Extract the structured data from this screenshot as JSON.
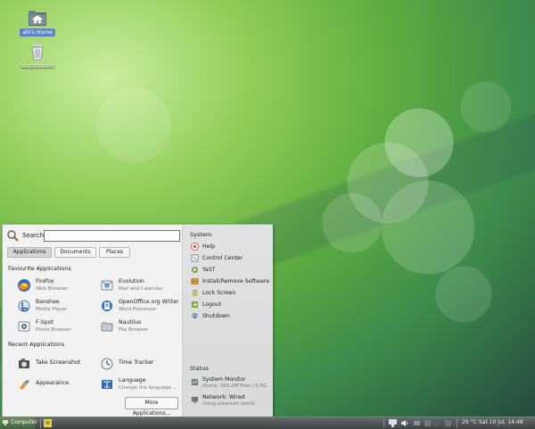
{
  "desktop": {
    "icons": [
      {
        "label": "ahl's Home",
        "icon": "home-folder-icon"
      },
      {
        "label": "Wastebasket",
        "icon": "trash-icon"
      }
    ]
  },
  "menu": {
    "search": {
      "label": "Search:",
      "value": ""
    },
    "tabs": [
      {
        "label": "Applications",
        "active": true
      },
      {
        "label": "Documents",
        "active": false
      },
      {
        "label": "Places",
        "active": false
      }
    ],
    "favourites_heading": "Favourite Applications",
    "favourites": [
      {
        "name": "Firefox",
        "description": "Web Browser",
        "icon": "firefox-icon"
      },
      {
        "name": "Evolution",
        "description": "Mail and Calendar",
        "icon": "evolution-icon"
      },
      {
        "name": "Banshee",
        "description": "Media Player",
        "icon": "banshee-icon"
      },
      {
        "name": "OpenOffice.org Writer",
        "description": "Word Processor",
        "icon": "writer-icon"
      },
      {
        "name": "F-Spot",
        "description": "Photo Browser",
        "icon": "fspot-icon"
      },
      {
        "name": "Nautilus",
        "description": "File Browser",
        "icon": "nautilus-icon"
      }
    ],
    "recent_heading": "Recent Applications",
    "recent": [
      {
        "name": "Take Screenshot",
        "description": "",
        "icon": "screenshot-icon"
      },
      {
        "name": "Time Tracker",
        "description": "",
        "icon": "time-tracker-icon"
      },
      {
        "name": "Appearance",
        "description": "",
        "icon": "appearance-icon"
      },
      {
        "name": "Language",
        "description": "Change the language ...",
        "icon": "language-icon"
      }
    ],
    "more_button": "More Applications...",
    "system": {
      "title": "System",
      "items": [
        {
          "label": "Help",
          "icon": "help-icon"
        },
        {
          "label": "Control Center",
          "icon": "control-center-icon"
        },
        {
          "label": "YaST",
          "icon": "yast-icon"
        },
        {
          "label": "Install/Remove Software",
          "icon": "install-software-icon"
        },
        {
          "label": "Lock Screen",
          "icon": "lock-icon"
        },
        {
          "label": "Logout",
          "icon": "logout-icon"
        },
        {
          "label": "Shutdown",
          "icon": "shutdown-icon"
        }
      ]
    },
    "status": {
      "title": "Status",
      "items": [
        {
          "name": "System Monitor",
          "description": "Home: 365.2M Free / 5.5G",
          "icon": "system-monitor-icon"
        },
        {
          "name": "Network: Wired",
          "description": "Using ethernet (eth0)",
          "icon": "network-icon"
        }
      ]
    }
  },
  "taskbar": {
    "computer_label": "Computer",
    "temperature": "29 °C",
    "clock": "Sat 10 Jul, 14:48",
    "colors": {
      "bar": "#4a4e50",
      "accent": "#6f9b5f"
    }
  }
}
